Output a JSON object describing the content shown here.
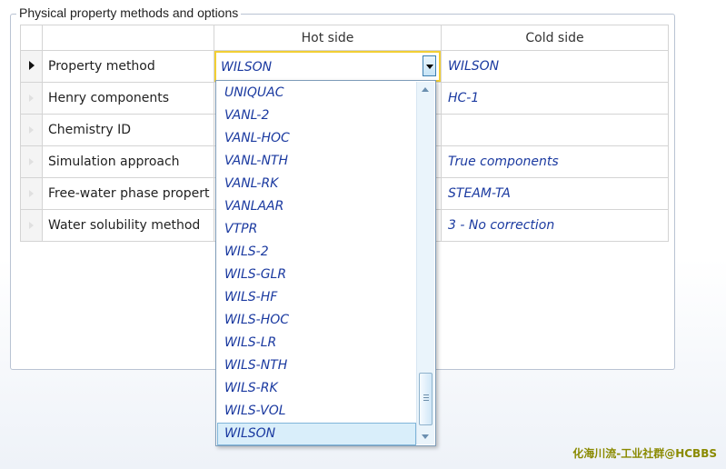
{
  "group": {
    "title": "Physical property methods and options"
  },
  "columns": {
    "hot": "Hot side",
    "cold": "Cold side"
  },
  "rows": [
    {
      "name": "Property method",
      "hot": "WILSON",
      "cold": "WILSON"
    },
    {
      "name": "Henry components",
      "hot": "",
      "cold": "HC-1"
    },
    {
      "name": "Chemistry ID",
      "hot": "",
      "cold": ""
    },
    {
      "name": "Simulation approach",
      "hot": "",
      "cold": "True components"
    },
    {
      "name": "Free-water phase propert",
      "hot": "",
      "cold": "STEAM-TA"
    },
    {
      "name": "Water solubility method",
      "hot": "",
      "cold": "3 - No correction"
    }
  ],
  "dropdown": {
    "items": [
      "UNIQUAC",
      "VANL-2",
      "VANL-HOC",
      "VANL-NTH",
      "VANL-RK",
      "VANLAAR",
      "VTPR",
      "WILS-2",
      "WILS-GLR",
      "WILS-HF",
      "WILS-HOC",
      "WILS-LR",
      "WILS-NTH",
      "WILS-RK",
      "WILS-VOL",
      "WILSON"
    ],
    "selected": "WILSON"
  },
  "watermark": "化海川流-工业社群@HCBBS",
  "colors": {
    "value_text": "#1b3aa0",
    "focus_border": "#f2cf34",
    "selection_bg": "#d9eefa"
  }
}
